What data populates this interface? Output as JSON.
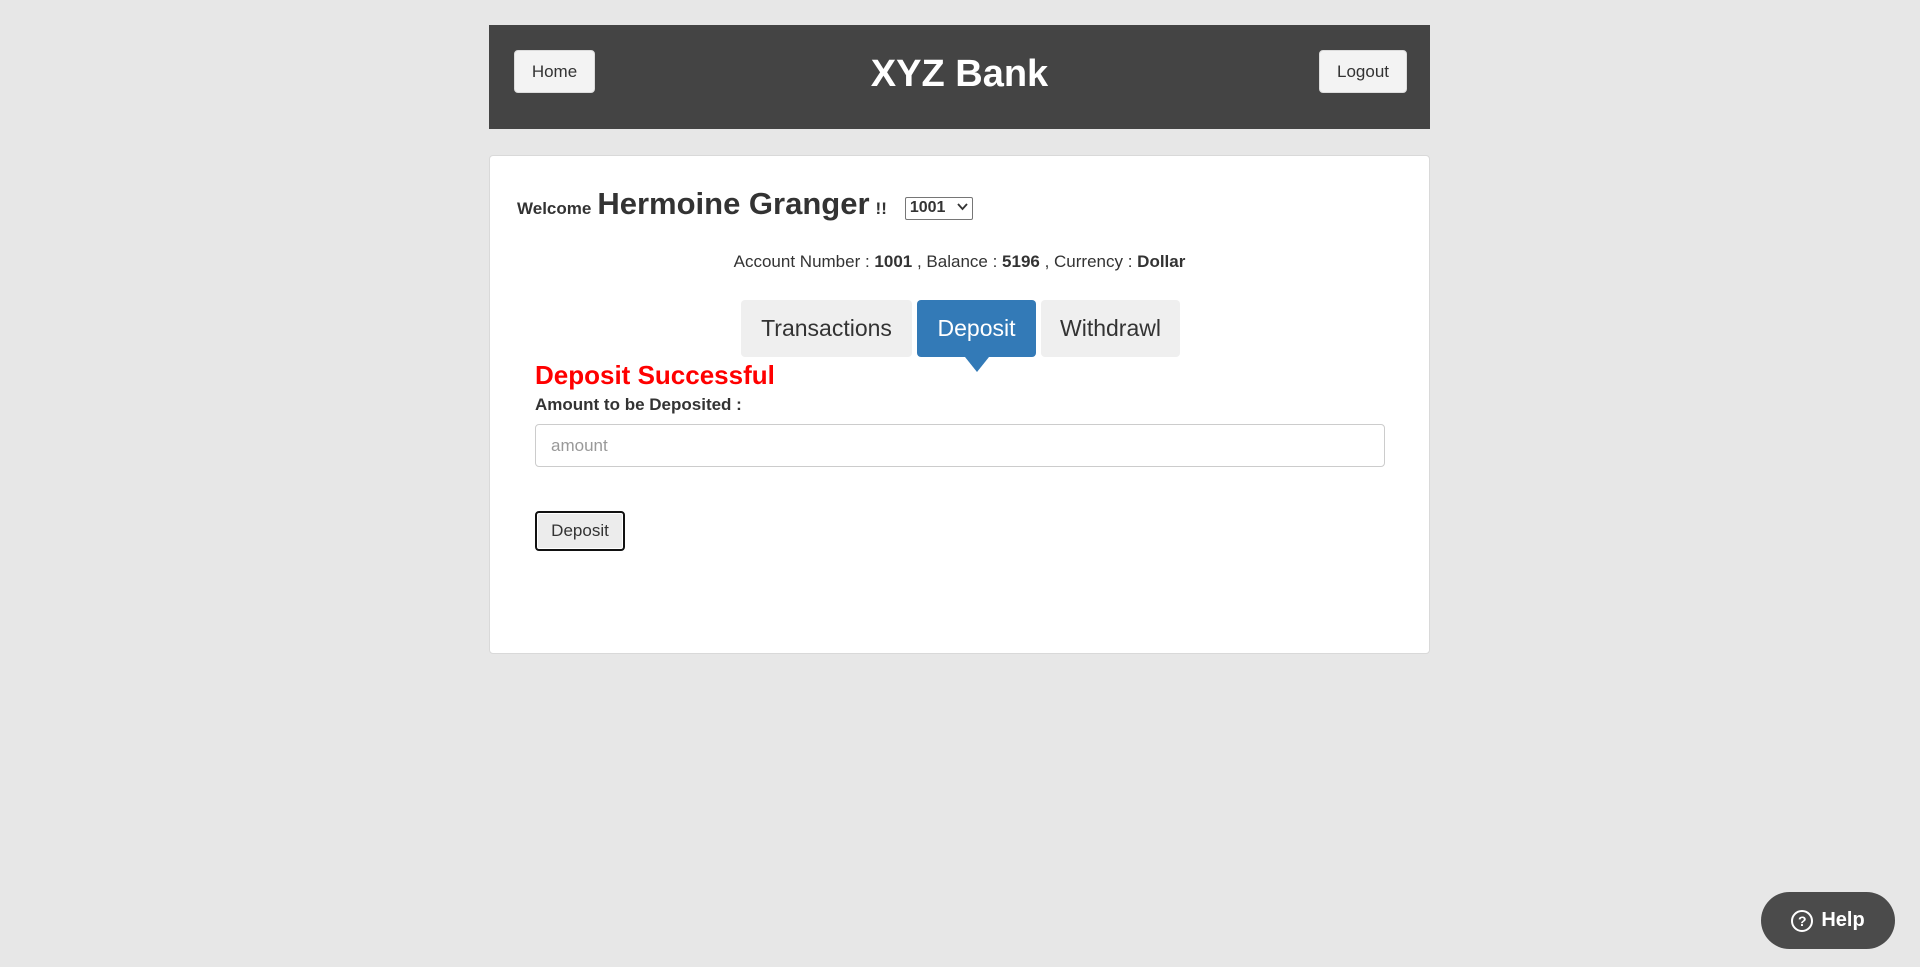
{
  "header": {
    "home_label": "Home",
    "title": "XYZ Bank",
    "logout_label": "Logout"
  },
  "welcome": {
    "prefix": "Welcome",
    "customer_name": "Hermoine Granger",
    "suffix": "!!",
    "selected_account": "1001"
  },
  "account_info": {
    "account_number_label": "Account Number : ",
    "account_number": "1001",
    "balance_label": " , Balance : ",
    "balance": "5196",
    "currency_label": " , Currency : ",
    "currency": "Dollar"
  },
  "tabs": [
    {
      "label": "Transactions",
      "active": false
    },
    {
      "label": "Deposit",
      "active": true
    },
    {
      "label": "Withdrawl",
      "active": false
    }
  ],
  "deposit_form": {
    "message": "Deposit Successful",
    "amount_label": "Amount to be Deposited :",
    "amount_value": "",
    "amount_placeholder": "amount",
    "submit_label": "Deposit"
  },
  "help": {
    "label": "Help",
    "icon": "question-circle-icon"
  },
  "colors": {
    "header_bg": "#444444",
    "active_tab": "#337ab7",
    "success_message": "#ff0000",
    "page_bg": "#e7e7e7"
  }
}
